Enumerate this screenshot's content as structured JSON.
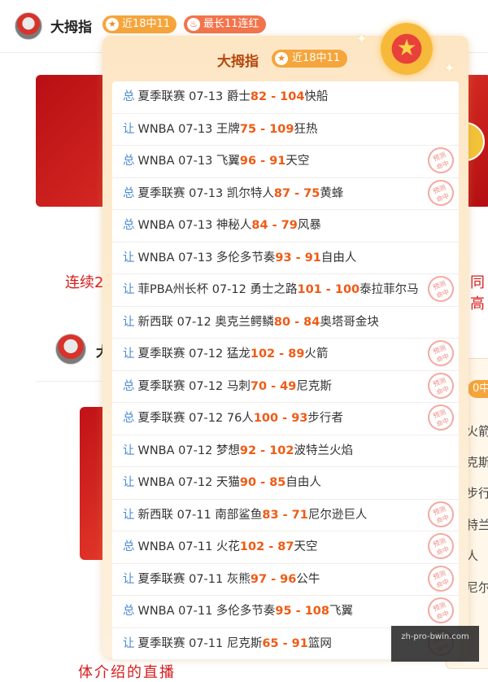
{
  "header": {
    "name": "大拇指",
    "badge_hit": "近18中11",
    "badge_streak": "最长11连红"
  },
  "background": {
    "text_left": "连续2",
    "text_right": "同高",
    "name2": "大",
    "card2_pill": "0中",
    "card2_frags": [
      "火箭",
      "克斯",
      "步行",
      "特兰",
      "人",
      "尼尔"
    ],
    "bottom_text": "体介绍的直播"
  },
  "popup": {
    "title": "大拇指",
    "badge": "近18中11",
    "stamp_line1": "预测",
    "stamp_line2": "命中",
    "rows": [
      {
        "type": "总",
        "league": "夏季联赛",
        "date": "07-13",
        "home": "爵士",
        "score": "82 - 104",
        "away": "快船",
        "hit": false
      },
      {
        "type": "让",
        "league": "WNBA",
        "date": "07-13",
        "home": "王牌",
        "score": "75 - 109",
        "away": "狂热",
        "hit": false
      },
      {
        "type": "总",
        "league": "WNBA",
        "date": "07-13",
        "home": "飞翼",
        "score": "96 - 91",
        "away": "天空",
        "hit": true
      },
      {
        "type": "总",
        "league": "夏季联赛",
        "date": "07-13",
        "home": "凯尔特人",
        "score": "87 - 75",
        "away": "黄蜂",
        "hit": true
      },
      {
        "type": "总",
        "league": "WNBA",
        "date": "07-13",
        "home": "神秘人",
        "score": "84 - 79",
        "away": "风暴",
        "hit": false
      },
      {
        "type": "让",
        "league": "WNBA",
        "date": "07-13",
        "home": "多伦多节奏",
        "score": "93 - 91",
        "away": "自由人",
        "hit": false
      },
      {
        "type": "让",
        "league": "菲PBA州长杯",
        "date": "07-12",
        "home": "勇士之路",
        "score": "101 - 100",
        "away": "泰拉菲尔马",
        "hit": true
      },
      {
        "type": "让",
        "league": "新西联",
        "date": "07-12",
        "home": "奥克兰鳄鳞",
        "score": "80 - 84",
        "away": "奥塔哥金块",
        "hit": false
      },
      {
        "type": "让",
        "league": "夏季联赛",
        "date": "07-12",
        "home": "猛龙",
        "score": "102 - 89",
        "away": "火箭",
        "hit": true
      },
      {
        "type": "总",
        "league": "夏季联赛",
        "date": "07-12",
        "home": "马刺",
        "score": "70 - 49",
        "away": "尼克斯",
        "hit": true
      },
      {
        "type": "总",
        "league": "夏季联赛",
        "date": "07-12",
        "home": "76人",
        "score": "100 - 93",
        "away": "步行者",
        "hit": true
      },
      {
        "type": "让",
        "league": "WNBA",
        "date": "07-12",
        "home": "梦想",
        "score": "92 - 102",
        "away": "波特兰火焰",
        "hit": false
      },
      {
        "type": "让",
        "league": "WNBA",
        "date": "07-12",
        "home": "天猫",
        "score": "90 - 85",
        "away": "自由人",
        "hit": false
      },
      {
        "type": "让",
        "league": "新西联",
        "date": "07-11",
        "home": "南部鲨鱼",
        "score": "83 - 71",
        "away": "尼尔逊巨人",
        "hit": true
      },
      {
        "type": "总",
        "league": "WNBA",
        "date": "07-11",
        "home": "火花",
        "score": "102 - 87",
        "away": "天空",
        "hit": true
      },
      {
        "type": "让",
        "league": "夏季联赛",
        "date": "07-11",
        "home": "灰熊",
        "score": "97 - 96",
        "away": "公牛",
        "hit": true
      },
      {
        "type": "总",
        "league": "WNBA",
        "date": "07-11",
        "home": "多伦多节奏",
        "score": "95 - 108",
        "away": "飞翼",
        "hit": true
      },
      {
        "type": "让",
        "league": "夏季联赛",
        "date": "07-11",
        "home": "尼克斯",
        "score": "65 - 91",
        "away": "篮网",
        "hit": true
      }
    ]
  },
  "watermark": {
    "line1": "",
    "line2": "zh-pro-bwin.com"
  },
  "colors": {
    "type": "#4a88d6",
    "score": "#f05a14",
    "title": "#b5460d",
    "badge": "#f5a53b",
    "streak": "#f2744c"
  }
}
